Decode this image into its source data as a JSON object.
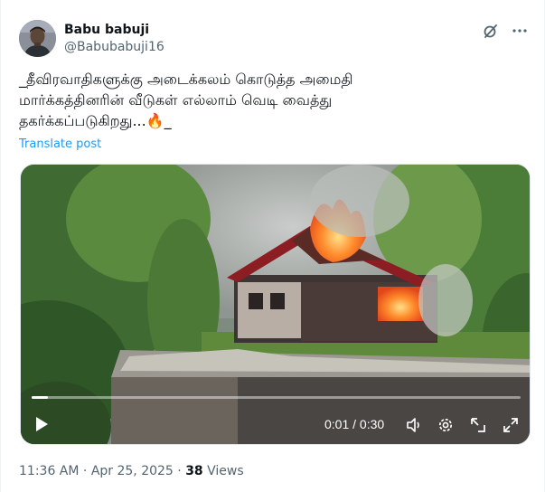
{
  "author": {
    "display_name": "Babu babuji",
    "handle": "@Babubabuji16"
  },
  "icons": {
    "grok": "grok-icon",
    "more": "more-icon"
  },
  "post": {
    "text": "_தீவிரவாதிகளுக்கு அடைக்கலம் கொடுத்த அமைதி\nமார்க்கத்தினரின் வீடுகள் எல்லாம் வெடி வைத்து\nதகர்க்கப்படுகிறது...🔥_",
    "translate_label": "Translate post"
  },
  "video": {
    "current_time": "0:01",
    "separator": " / ",
    "duration": "0:30",
    "progress": 0.033
  },
  "meta": {
    "time": "11:36 AM",
    "dot": " · ",
    "date": "Apr 25, 2025",
    "views_count": "38",
    "views_label": " Views"
  },
  "colors": {
    "link": "#1d9bf0",
    "muted": "#536471",
    "text": "#0f1419"
  }
}
